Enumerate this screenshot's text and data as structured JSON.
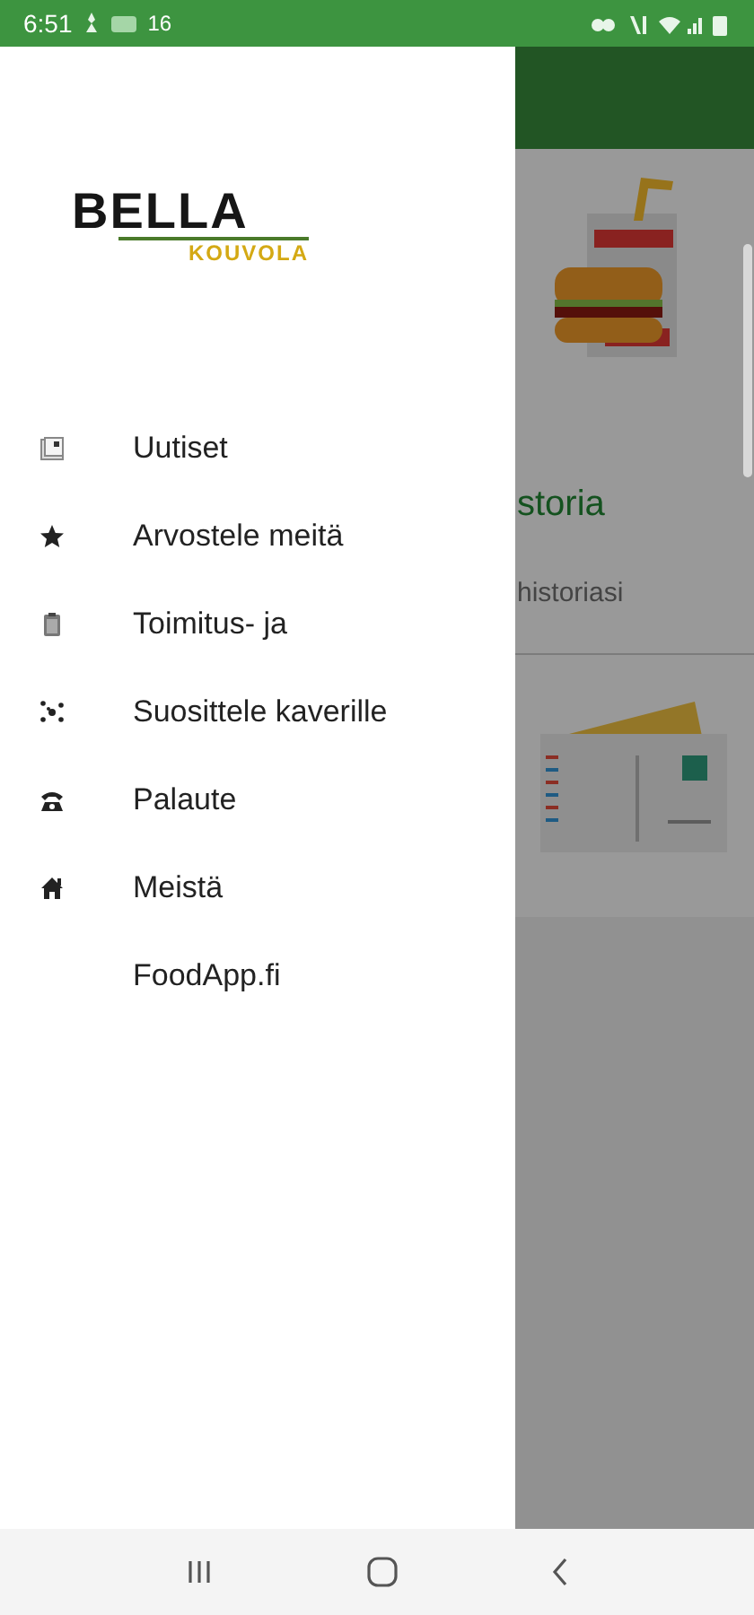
{
  "status_bar": {
    "time": "6:51",
    "notification_count": "16"
  },
  "drawer": {
    "logo": {
      "title": "BELLA",
      "subtitle": "KOUVOLA"
    },
    "items": [
      {
        "label": "Uutiset"
      },
      {
        "label": "Arvostele meitä"
      },
      {
        "label": "Toimitus- ja"
      },
      {
        "label": "Suosittele kaverille"
      },
      {
        "label": "Palaute"
      },
      {
        "label": "Meistä"
      },
      {
        "label": "FoodApp.fi"
      }
    ]
  },
  "background": {
    "section_title": "storia",
    "section_subtitle": "historiasi"
  }
}
